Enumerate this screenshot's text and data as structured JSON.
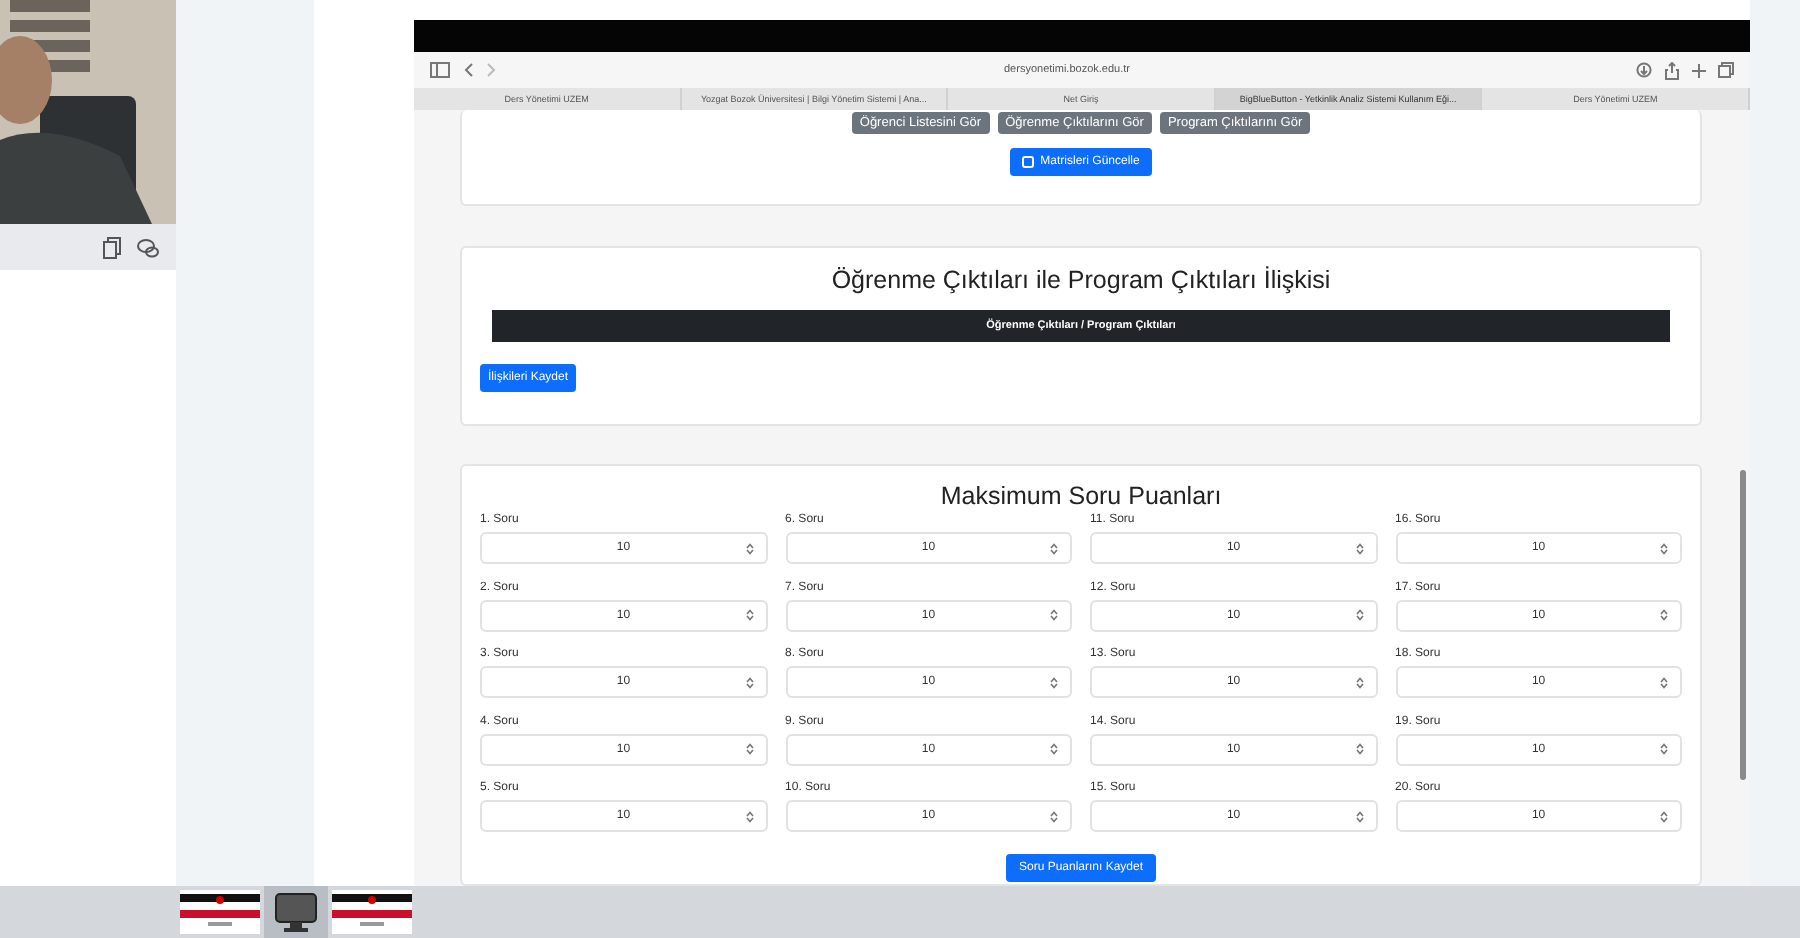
{
  "browser": {
    "url": "dersyonetimi.bozok.edu.tr",
    "tabs": [
      {
        "label": "Ders Yönetimi UZEM",
        "selected": false
      },
      {
        "label": "Yozgat Bozok Üniversitesi | Bilgi Yönetim Sistemi | Ana...",
        "selected": false
      },
      {
        "label": "Net Giriş",
        "selected": false
      },
      {
        "label": "BigBlueButton - Yetkinlik Analiz Sistemi Kullanım Eği...",
        "selected": true
      },
      {
        "label": "Ders Yönetimi UZEM",
        "selected": false
      }
    ]
  },
  "matrix_card": {
    "buttons": [
      "Öğrenci Listesini Gör",
      "Öğrenme Çıktılarını Gör",
      "Program Çıktılarını Gör"
    ],
    "update_button": "Matrisleri Güncelle"
  },
  "relation_card": {
    "title": "Öğrenme Çıktıları ile Program Çıktıları İlişkisi",
    "table_header": "Öğrenme Çıktıları / Program Çıktıları",
    "save_button": "İlişkileri Kaydet"
  },
  "score_card": {
    "title": "Maksimum Soru Puanları",
    "columns": [
      [
        {
          "label": "1. Soru",
          "value": "10"
        },
        {
          "label": "2. Soru",
          "value": "10"
        },
        {
          "label": "3. Soru",
          "value": "10"
        },
        {
          "label": "4. Soru",
          "value": "10"
        },
        {
          "label": "5. Soru",
          "value": "10"
        }
      ],
      [
        {
          "label": "6. Soru",
          "value": "10"
        },
        {
          "label": "7. Soru",
          "value": "10"
        },
        {
          "label": "8. Soru",
          "value": "10"
        },
        {
          "label": "9. Soru",
          "value": "10"
        },
        {
          "label": "10. Soru",
          "value": "10"
        }
      ],
      [
        {
          "label": "11. Soru",
          "value": "10"
        },
        {
          "label": "12. Soru",
          "value": "10"
        },
        {
          "label": "13. Soru",
          "value": "10"
        },
        {
          "label": "14. Soru",
          "value": "10"
        },
        {
          "label": "15. Soru",
          "value": "10"
        }
      ],
      [
        {
          "label": "16. Soru",
          "value": "10"
        },
        {
          "label": "17. Soru",
          "value": "10"
        },
        {
          "label": "18. Soru",
          "value": "10"
        },
        {
          "label": "19. Soru",
          "value": "10"
        },
        {
          "label": "20. Soru",
          "value": "10"
        }
      ]
    ],
    "save_button": "Soru Puanlarını Kaydet"
  }
}
